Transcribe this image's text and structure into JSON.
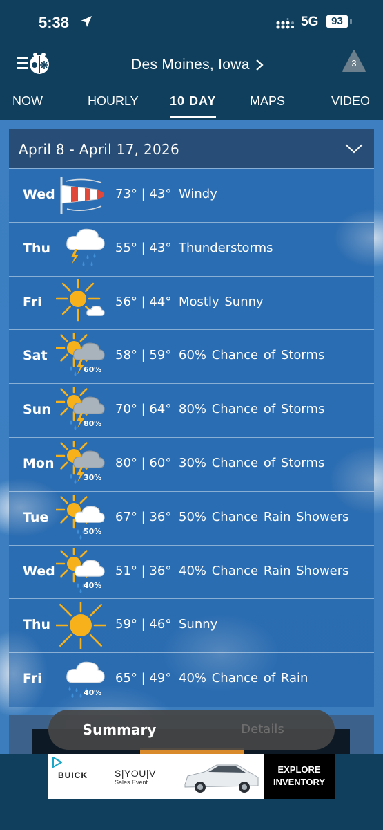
{
  "status_bar": {
    "time": "5:38",
    "network": "5G",
    "battery": "93"
  },
  "header": {
    "location": "Des Moines, Iowa",
    "alert_count": "3"
  },
  "tabs": [
    {
      "label": "NOW",
      "active": false
    },
    {
      "label": "HOURLY",
      "active": false
    },
    {
      "label": "10 DAY",
      "active": true
    },
    {
      "label": "MAPS",
      "active": false
    },
    {
      "label": "VIDEO",
      "active": false
    }
  ],
  "forecast": {
    "range": "April 8 - April 17, 2026",
    "days": [
      {
        "day": "Wed",
        "high": "73°",
        "low": "43°",
        "condition": "Windy",
        "icon": "windsock-icon",
        "precip": ""
      },
      {
        "day": "Thu",
        "high": "55°",
        "low": "43°",
        "condition": "Thunderstorms",
        "icon": "thunderstorm-icon",
        "precip": ""
      },
      {
        "day": "Fri",
        "high": "56°",
        "low": "44°",
        "condition": "Mostly Sunny",
        "icon": "mostly-sunny-icon",
        "precip": ""
      },
      {
        "day": "Sat",
        "high": "58°",
        "low": "59°",
        "condition": "60% Chance of Storms",
        "icon": "sun-storm-icon",
        "precip": "60%"
      },
      {
        "day": "Sun",
        "high": "70°",
        "low": "64°",
        "condition": "80% Chance of Storms",
        "icon": "sun-storm-icon",
        "precip": "80%"
      },
      {
        "day": "Mon",
        "high": "80°",
        "low": "60°",
        "condition": "30% Chance of Storms",
        "icon": "sun-storm-icon",
        "precip": "30%"
      },
      {
        "day": "Tue",
        "high": "67°",
        "low": "36°",
        "condition": "50% Chance Rain Showers",
        "icon": "sun-rain-icon",
        "precip": "50%"
      },
      {
        "day": "Wed",
        "high": "51°",
        "low": "36°",
        "condition": "40% Chance Rain Showers",
        "icon": "sun-rain-icon",
        "precip": "40%"
      },
      {
        "day": "Thu",
        "high": "59°",
        "low": "46°",
        "condition": "Sunny",
        "icon": "sunny-icon",
        "precip": ""
      },
      {
        "day": "Fri",
        "high": "65°",
        "low": "49°",
        "condition": "40% Chance of Rain",
        "icon": "rain-icon",
        "precip": "40%"
      }
    ]
  },
  "view_toggle": {
    "summary": "Summary",
    "details": "Details"
  },
  "ad": {
    "brand": "BUICK",
    "headline": "S|YOU|V",
    "sub": "Sales Event",
    "cta_line1": "EXPLORE",
    "cta_line2": "INVENTORY"
  },
  "colors": {
    "header_bg": "#0f3f5c",
    "sun": "#f7b21b",
    "rain": "#3f8fd9",
    "windsock": "#e0483a"
  }
}
